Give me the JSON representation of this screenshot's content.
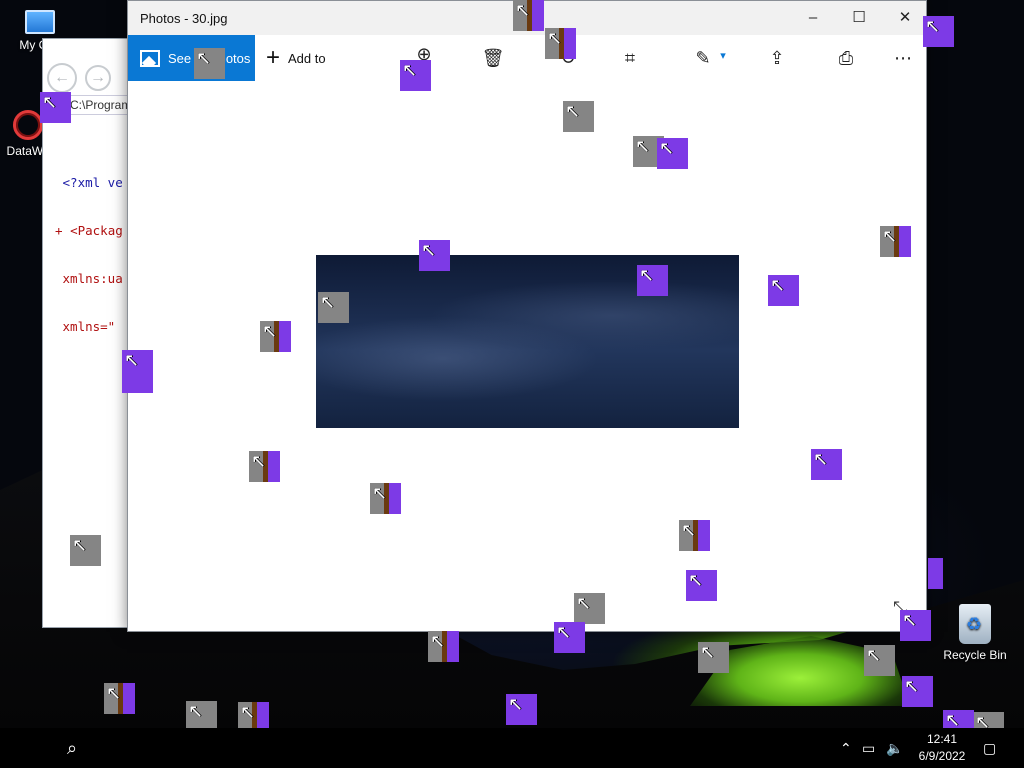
{
  "desktop": {
    "icons": [
      {
        "label": "My Con",
        "icon": "computer-icon"
      },
      {
        "label": "DataWa",
        "icon": "datawarrior-icon"
      },
      {
        "label": "Recycle Bin",
        "icon": "recycle-bin-icon"
      }
    ]
  },
  "ie_window": {
    "address": "C:\\Program",
    "xml_lines": [
      {
        "prefix": "",
        "text": "<?xml ve"
      },
      {
        "prefix": "+",
        "text": "<Packag"
      },
      {
        "prefix": "",
        "text": "xmlns:ua"
      },
      {
        "prefix": "",
        "text": "xmlns=\""
      }
    ]
  },
  "photos": {
    "title": "Photos - 30.jpg",
    "controls": {
      "minimize": "–",
      "maximize": "☐",
      "close": "✕"
    },
    "toolbar": {
      "see_all_label": "See all photos",
      "add_to_label": "Add to",
      "icons": [
        "zoom-icon",
        "delete-icon",
        "rotate-icon",
        "crop-icon",
        "edit-icon",
        "share-icon",
        "print-icon",
        "more-icon"
      ]
    },
    "image_file": "30.jpg"
  },
  "taskbar": {
    "clock_time": "12:41",
    "clock_date": "6/9/2022",
    "tray_icons": [
      "chevron-up-icon",
      "network-icon",
      "volume-icon",
      "notification-icon"
    ]
  },
  "colors": {
    "accent": "#0a78d4",
    "artifact_purple": "#7d3ae6",
    "artifact_gray": "#858585"
  }
}
